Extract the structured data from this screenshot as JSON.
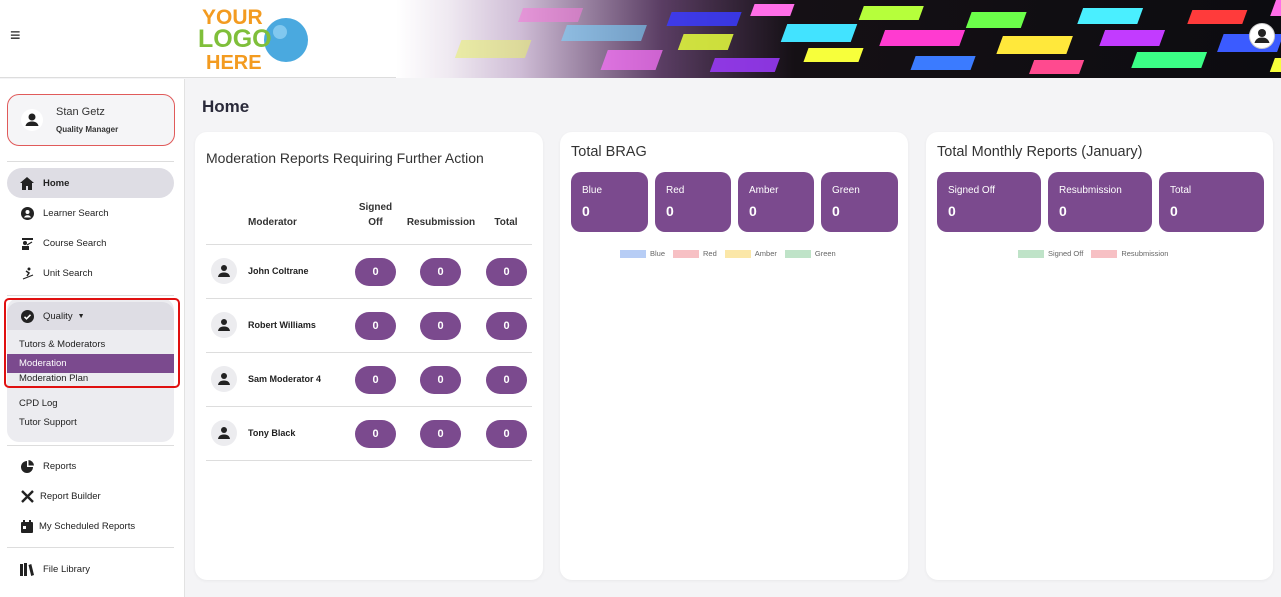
{
  "header": {
    "logo_lines": [
      "YOUR",
      "LOGO",
      "HERE"
    ]
  },
  "user": {
    "name": "Stan Getz",
    "role": "Quality Manager"
  },
  "nav": {
    "home": "Home",
    "learner_search": "Learner Search",
    "course_search": "Course Search",
    "unit_search": "Unit Search",
    "quality": "Quality",
    "quality_items": [
      "Tutors & Moderators",
      "Moderation",
      "Moderation Plan",
      "CPD Log",
      "Tutor Support"
    ],
    "reports": "Reports",
    "report_builder": "Report Builder",
    "scheduled_reports": "My Scheduled Reports",
    "file_library": "File Library"
  },
  "page": {
    "title": "Home"
  },
  "moderation": {
    "title": "Moderation Reports Requiring Further Action",
    "headers": {
      "moderator": "Moderator",
      "signed_off_1": "Signed",
      "signed_off_2": "Off",
      "resubmission": "Resubmission",
      "total": "Total"
    },
    "rows": [
      {
        "name": "John Coltrane",
        "signed_off": "0",
        "resubmission": "0",
        "total": "0"
      },
      {
        "name": "Robert Williams",
        "signed_off": "0",
        "resubmission": "0",
        "total": "0"
      },
      {
        "name": "Sam Moderator 4",
        "signed_off": "0",
        "resubmission": "0",
        "total": "0"
      },
      {
        "name": "Tony Black",
        "signed_off": "0",
        "resubmission": "0",
        "total": "0"
      }
    ]
  },
  "brag": {
    "title": "Total BRAG",
    "tiles": [
      {
        "label": "Blue",
        "value": "0"
      },
      {
        "label": "Red",
        "value": "0"
      },
      {
        "label": "Amber",
        "value": "0"
      },
      {
        "label": "Green",
        "value": "0"
      }
    ],
    "legend": [
      {
        "label": "Blue",
        "color": "#b7cdf5"
      },
      {
        "label": "Red",
        "color": "#f7c0c4"
      },
      {
        "label": "Amber",
        "color": "#fbe7a8"
      },
      {
        "label": "Green",
        "color": "#bfe3c8"
      }
    ]
  },
  "monthly": {
    "title": "Total Monthly Reports (January)",
    "tiles": [
      {
        "label": "Signed Off",
        "value": "0"
      },
      {
        "label": "Resubmission",
        "value": "0"
      },
      {
        "label": "Total",
        "value": "0"
      }
    ],
    "legend": [
      {
        "label": "Signed Off",
        "color": "#bfe3c8"
      },
      {
        "label": "Resubmission",
        "color": "#f7c0c4"
      }
    ]
  },
  "colors": {
    "accent": "#7b4a8e",
    "highlight": "#e01010"
  }
}
